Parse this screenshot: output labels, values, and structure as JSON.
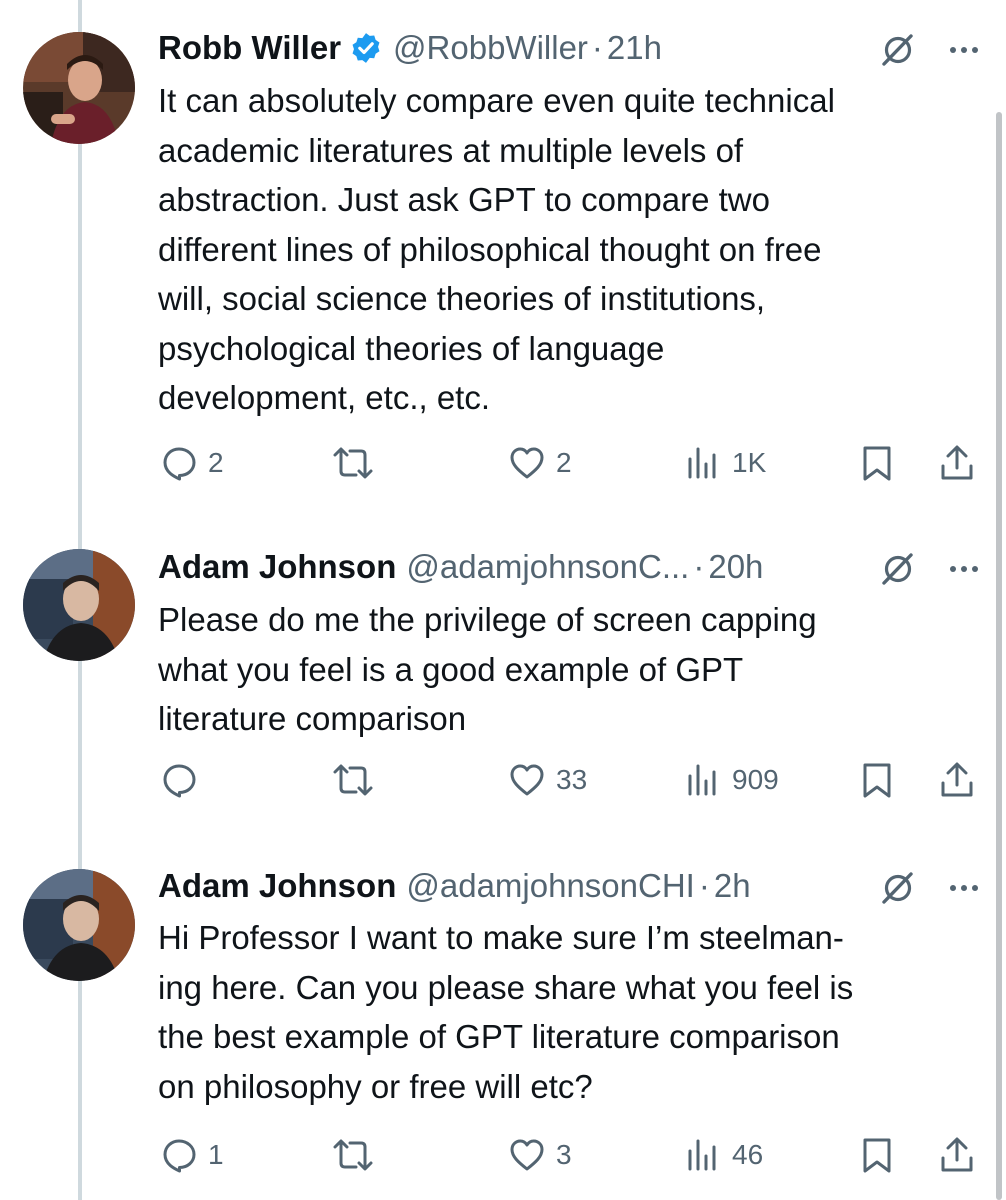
{
  "tweets": [
    {
      "author": {
        "name": "Robb Willer",
        "handle": "@RobbWiller",
        "verified": true
      },
      "separator": "·",
      "time": "21h",
      "text": "It can absolutely compare even quite technical\nacademic literatures at multiple levels of\nabstraction. Just ask GPT to compare two\ndifferent lines of philosophical thought on free\nwill, social science theories of institutions,\npsychological theories of language\ndevelopment, etc., etc.",
      "stats": {
        "replies": "2",
        "retweets": "",
        "likes": "2",
        "views": "1K"
      }
    },
    {
      "author": {
        "name": "Adam Johnson",
        "handle": "@adamjohnsonC...",
        "verified": false
      },
      "separator": "·",
      "time": "20h",
      "text": "Please do me the privilege of screen capping\nwhat you feel is a good example of GPT\nliterature comparison",
      "stats": {
        "replies": "",
        "retweets": "",
        "likes": "33",
        "views": "909"
      }
    },
    {
      "author": {
        "name": "Adam Johnson",
        "handle": "@adamjohnsonCHI",
        "verified": false
      },
      "separator": "·",
      "time": "2h",
      "text": "Hi Professor I want to make sure I’m steelman-\ning here. Can you please share what you feel is\nthe best example of GPT literature comparison\non philosophy or free will etc?",
      "stats": {
        "replies": "1",
        "retweets": "",
        "likes": "3",
        "views": "46"
      }
    }
  ],
  "colors": {
    "text": "#0f1419",
    "secondary": "#536471",
    "verified": "#1d9bf0",
    "thread_line": "#cfd9de"
  },
  "icons": {
    "verified": "verified-badge-icon",
    "grok": "grok-icon",
    "more": "more-icon",
    "reply": "reply-icon",
    "retweet": "retweet-icon",
    "like": "like-icon",
    "views": "views-icon",
    "bookmark": "bookmark-icon",
    "share": "share-icon"
  }
}
